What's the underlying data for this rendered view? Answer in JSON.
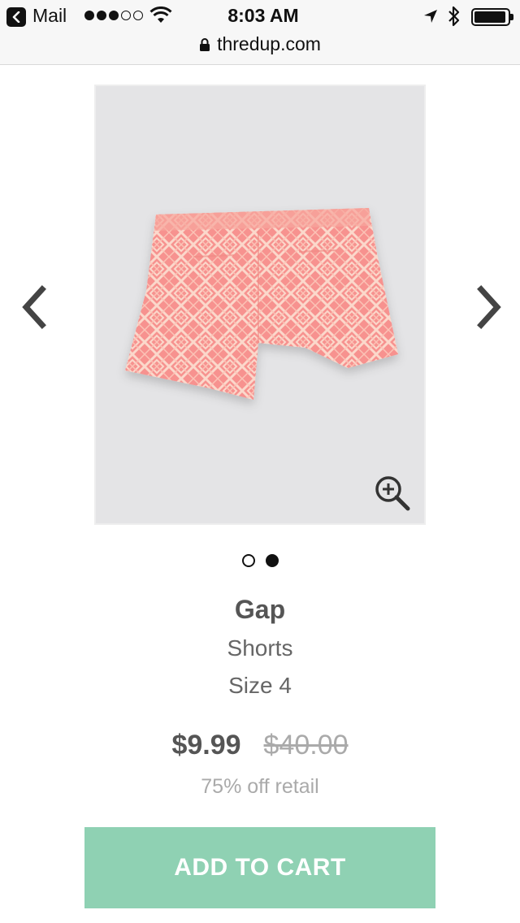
{
  "status_bar": {
    "back_label": "Mail",
    "time": "8:03 AM",
    "signal_bars_filled": 3,
    "signal_bars_total": 5
  },
  "address_bar": {
    "url": "thredup.com"
  },
  "product": {
    "brand": "Gap",
    "category": "Shorts",
    "size": "Size 4",
    "price": "$9.99",
    "retail_price": "$40.00",
    "discount": "75% off retail",
    "image_count": 2,
    "active_image_index": 2
  },
  "actions": {
    "add_to_cart": "ADD TO CART"
  },
  "colors": {
    "add_to_cart_bg": "#8fd1b3",
    "shorts_pink": "#f7928f",
    "image_bg": "#e4e4e6"
  },
  "icons": {
    "back": "chevron-left-icon",
    "prev": "chevron-left-icon",
    "next": "chevron-right-icon",
    "zoom": "zoom-in-icon",
    "lock": "lock-icon",
    "wifi": "wifi-icon",
    "location": "location-arrow-icon",
    "bluetooth": "bluetooth-icon",
    "battery": "battery-icon"
  }
}
